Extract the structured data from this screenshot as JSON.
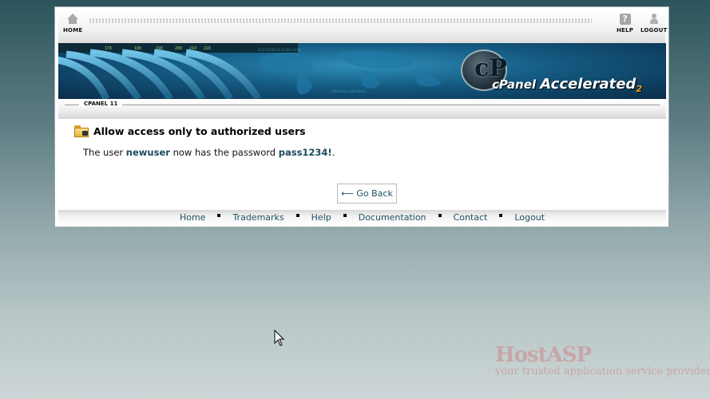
{
  "topbar": {
    "home_label": "HOME",
    "help_label": "HELP",
    "logout_label": "LOGOUT"
  },
  "banner": {
    "logo_mark": "cP",
    "logo_text_cpanel": "cPanel",
    "logo_text_accelerated": "Accelerated",
    "logo_text_version": "2"
  },
  "section": {
    "label": "CPANEL 11"
  },
  "content": {
    "heading": "Allow access only to authorized users",
    "message_prefix": "The user",
    "username": "newuser",
    "message_middle": "now has the password",
    "password": "pass1234!",
    "message_suffix": ".",
    "go_back_label": "⟵ Go Back"
  },
  "footer": {
    "links": [
      "Home",
      "Trademarks",
      "Help",
      "Documentation",
      "Contact",
      "Logout"
    ]
  },
  "watermark": {
    "title": "HostASP",
    "subtitle": "your trusted application service provider"
  },
  "colors": {
    "link": "#1e4f63",
    "background_top": "#2d545c",
    "background_bottom": "#cdd6d6"
  }
}
